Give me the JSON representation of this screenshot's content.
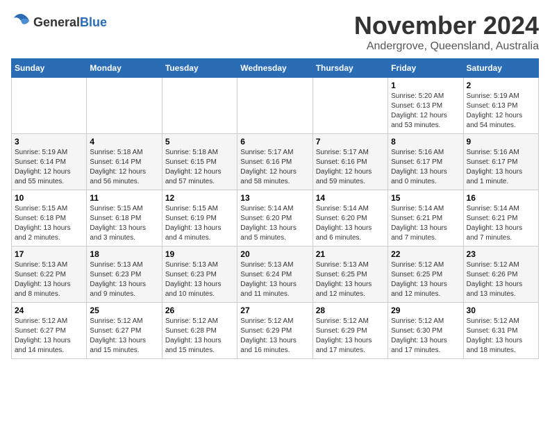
{
  "logo": {
    "general": "General",
    "blue": "Blue"
  },
  "title": "November 2024",
  "location": "Andergrove, Queensland, Australia",
  "weekdays": [
    "Sunday",
    "Monday",
    "Tuesday",
    "Wednesday",
    "Thursday",
    "Friday",
    "Saturday"
  ],
  "weeks": [
    [
      {
        "day": "",
        "info": ""
      },
      {
        "day": "",
        "info": ""
      },
      {
        "day": "",
        "info": ""
      },
      {
        "day": "",
        "info": ""
      },
      {
        "day": "",
        "info": ""
      },
      {
        "day": "1",
        "info": "Sunrise: 5:20 AM\nSunset: 6:13 PM\nDaylight: 12 hours\nand 53 minutes."
      },
      {
        "day": "2",
        "info": "Sunrise: 5:19 AM\nSunset: 6:13 PM\nDaylight: 12 hours\nand 54 minutes."
      }
    ],
    [
      {
        "day": "3",
        "info": "Sunrise: 5:19 AM\nSunset: 6:14 PM\nDaylight: 12 hours\nand 55 minutes."
      },
      {
        "day": "4",
        "info": "Sunrise: 5:18 AM\nSunset: 6:14 PM\nDaylight: 12 hours\nand 56 minutes."
      },
      {
        "day": "5",
        "info": "Sunrise: 5:18 AM\nSunset: 6:15 PM\nDaylight: 12 hours\nand 57 minutes."
      },
      {
        "day": "6",
        "info": "Sunrise: 5:17 AM\nSunset: 6:16 PM\nDaylight: 12 hours\nand 58 minutes."
      },
      {
        "day": "7",
        "info": "Sunrise: 5:17 AM\nSunset: 6:16 PM\nDaylight: 12 hours\nand 59 minutes."
      },
      {
        "day": "8",
        "info": "Sunrise: 5:16 AM\nSunset: 6:17 PM\nDaylight: 13 hours\nand 0 minutes."
      },
      {
        "day": "9",
        "info": "Sunrise: 5:16 AM\nSunset: 6:17 PM\nDaylight: 13 hours\nand 1 minute."
      }
    ],
    [
      {
        "day": "10",
        "info": "Sunrise: 5:15 AM\nSunset: 6:18 PM\nDaylight: 13 hours\nand 2 minutes."
      },
      {
        "day": "11",
        "info": "Sunrise: 5:15 AM\nSunset: 6:18 PM\nDaylight: 13 hours\nand 3 minutes."
      },
      {
        "day": "12",
        "info": "Sunrise: 5:15 AM\nSunset: 6:19 PM\nDaylight: 13 hours\nand 4 minutes."
      },
      {
        "day": "13",
        "info": "Sunrise: 5:14 AM\nSunset: 6:20 PM\nDaylight: 13 hours\nand 5 minutes."
      },
      {
        "day": "14",
        "info": "Sunrise: 5:14 AM\nSunset: 6:20 PM\nDaylight: 13 hours\nand 6 minutes."
      },
      {
        "day": "15",
        "info": "Sunrise: 5:14 AM\nSunset: 6:21 PM\nDaylight: 13 hours\nand 7 minutes."
      },
      {
        "day": "16",
        "info": "Sunrise: 5:14 AM\nSunset: 6:21 PM\nDaylight: 13 hours\nand 7 minutes."
      }
    ],
    [
      {
        "day": "17",
        "info": "Sunrise: 5:13 AM\nSunset: 6:22 PM\nDaylight: 13 hours\nand 8 minutes."
      },
      {
        "day": "18",
        "info": "Sunrise: 5:13 AM\nSunset: 6:23 PM\nDaylight: 13 hours\nand 9 minutes."
      },
      {
        "day": "19",
        "info": "Sunrise: 5:13 AM\nSunset: 6:23 PM\nDaylight: 13 hours\nand 10 minutes."
      },
      {
        "day": "20",
        "info": "Sunrise: 5:13 AM\nSunset: 6:24 PM\nDaylight: 13 hours\nand 11 minutes."
      },
      {
        "day": "21",
        "info": "Sunrise: 5:13 AM\nSunset: 6:25 PM\nDaylight: 13 hours\nand 12 minutes."
      },
      {
        "day": "22",
        "info": "Sunrise: 5:12 AM\nSunset: 6:25 PM\nDaylight: 13 hours\nand 12 minutes."
      },
      {
        "day": "23",
        "info": "Sunrise: 5:12 AM\nSunset: 6:26 PM\nDaylight: 13 hours\nand 13 minutes."
      }
    ],
    [
      {
        "day": "24",
        "info": "Sunrise: 5:12 AM\nSunset: 6:27 PM\nDaylight: 13 hours\nand 14 minutes."
      },
      {
        "day": "25",
        "info": "Sunrise: 5:12 AM\nSunset: 6:27 PM\nDaylight: 13 hours\nand 15 minutes."
      },
      {
        "day": "26",
        "info": "Sunrise: 5:12 AM\nSunset: 6:28 PM\nDaylight: 13 hours\nand 15 minutes."
      },
      {
        "day": "27",
        "info": "Sunrise: 5:12 AM\nSunset: 6:29 PM\nDaylight: 13 hours\nand 16 minutes."
      },
      {
        "day": "28",
        "info": "Sunrise: 5:12 AM\nSunset: 6:29 PM\nDaylight: 13 hours\nand 17 minutes."
      },
      {
        "day": "29",
        "info": "Sunrise: 5:12 AM\nSunset: 6:30 PM\nDaylight: 13 hours\nand 17 minutes."
      },
      {
        "day": "30",
        "info": "Sunrise: 5:12 AM\nSunset: 6:31 PM\nDaylight: 13 hours\nand 18 minutes."
      }
    ]
  ]
}
